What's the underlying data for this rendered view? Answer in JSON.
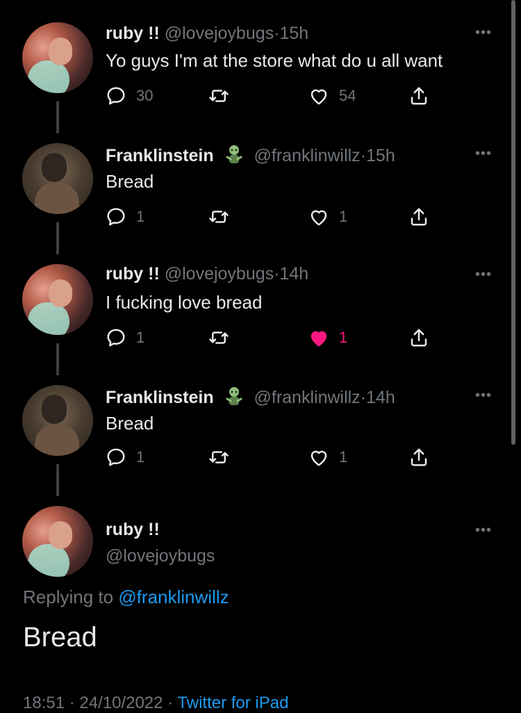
{
  "tweets": [
    {
      "name": "ruby !!",
      "handle": "@lovejoybugs",
      "time": "15h",
      "text": "Yo guys I'm at the store what do u all want",
      "replies": "30",
      "retweets": "",
      "likes": "54",
      "liked": false
    },
    {
      "name": "Franklinstein",
      "handle": "@franklinwillz",
      "time": "15h",
      "text": "Bread",
      "replies": "1",
      "retweets": "",
      "likes": "1",
      "liked": false
    },
    {
      "name": "ruby !!",
      "handle": "@lovejoybugs",
      "time": "14h",
      "text": "I fucking love bread",
      "replies": "1",
      "retweets": "",
      "likes": "1",
      "liked": true
    },
    {
      "name": "Franklinstein",
      "handle": "@franklinwillz",
      "time": "14h",
      "text": "Bread",
      "replies": "1",
      "retweets": "",
      "likes": "1",
      "liked": false
    }
  ],
  "main_tweet": {
    "name": "ruby !!",
    "handle": "@lovejoybugs",
    "replying_prefix": "Replying to ",
    "replying_to": "@franklinwillz",
    "text": "Bread",
    "footer_time": "18:51 · 24/10/2022 · ",
    "footer_source": "Twitter for iPad"
  },
  "common": {
    "separator": "·",
    "more": "•••"
  },
  "colors": {
    "background": "#000000",
    "text": "#e7e9ea",
    "muted": "#71767b",
    "link": "#1d9bf0",
    "like": "#f91880"
  },
  "icons": {
    "reply": "reply-icon",
    "retweet": "retweet-icon",
    "like": "heart-icon",
    "share": "share-icon",
    "badge": "zombie-emoji-icon"
  }
}
